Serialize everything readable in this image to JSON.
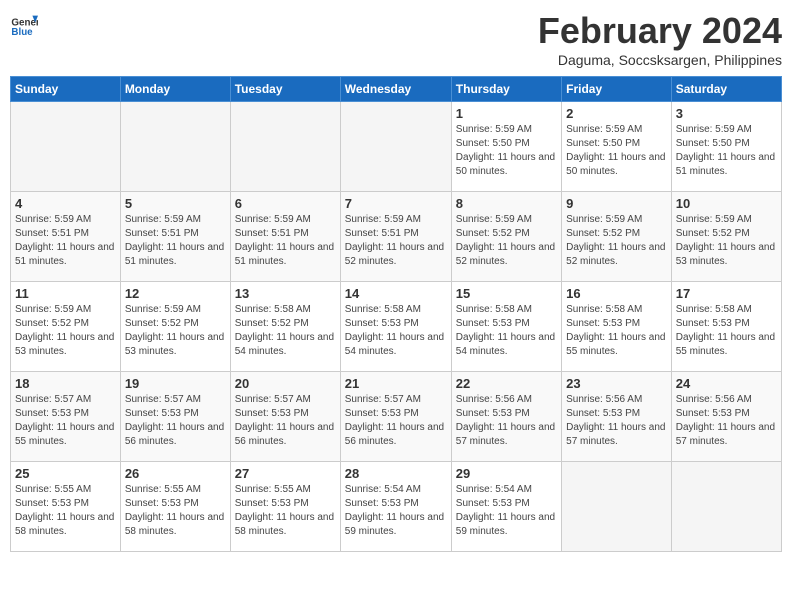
{
  "header": {
    "logo_line1": "General",
    "logo_line2": "Blue",
    "month_title": "February 2024",
    "location": "Daguma, Soccsksargen, Philippines"
  },
  "weekdays": [
    "Sunday",
    "Monday",
    "Tuesday",
    "Wednesday",
    "Thursday",
    "Friday",
    "Saturday"
  ],
  "weeks": [
    [
      {
        "day": "",
        "info": ""
      },
      {
        "day": "",
        "info": ""
      },
      {
        "day": "",
        "info": ""
      },
      {
        "day": "",
        "info": ""
      },
      {
        "day": "1",
        "info": "Sunrise: 5:59 AM\nSunset: 5:50 PM\nDaylight: 11 hours and 50 minutes."
      },
      {
        "day": "2",
        "info": "Sunrise: 5:59 AM\nSunset: 5:50 PM\nDaylight: 11 hours and 50 minutes."
      },
      {
        "day": "3",
        "info": "Sunrise: 5:59 AM\nSunset: 5:50 PM\nDaylight: 11 hours and 51 minutes."
      }
    ],
    [
      {
        "day": "4",
        "info": "Sunrise: 5:59 AM\nSunset: 5:51 PM\nDaylight: 11 hours and 51 minutes."
      },
      {
        "day": "5",
        "info": "Sunrise: 5:59 AM\nSunset: 5:51 PM\nDaylight: 11 hours and 51 minutes."
      },
      {
        "day": "6",
        "info": "Sunrise: 5:59 AM\nSunset: 5:51 PM\nDaylight: 11 hours and 51 minutes."
      },
      {
        "day": "7",
        "info": "Sunrise: 5:59 AM\nSunset: 5:51 PM\nDaylight: 11 hours and 52 minutes."
      },
      {
        "day": "8",
        "info": "Sunrise: 5:59 AM\nSunset: 5:52 PM\nDaylight: 11 hours and 52 minutes."
      },
      {
        "day": "9",
        "info": "Sunrise: 5:59 AM\nSunset: 5:52 PM\nDaylight: 11 hours and 52 minutes."
      },
      {
        "day": "10",
        "info": "Sunrise: 5:59 AM\nSunset: 5:52 PM\nDaylight: 11 hours and 53 minutes."
      }
    ],
    [
      {
        "day": "11",
        "info": "Sunrise: 5:59 AM\nSunset: 5:52 PM\nDaylight: 11 hours and 53 minutes."
      },
      {
        "day": "12",
        "info": "Sunrise: 5:59 AM\nSunset: 5:52 PM\nDaylight: 11 hours and 53 minutes."
      },
      {
        "day": "13",
        "info": "Sunrise: 5:58 AM\nSunset: 5:52 PM\nDaylight: 11 hours and 54 minutes."
      },
      {
        "day": "14",
        "info": "Sunrise: 5:58 AM\nSunset: 5:53 PM\nDaylight: 11 hours and 54 minutes."
      },
      {
        "day": "15",
        "info": "Sunrise: 5:58 AM\nSunset: 5:53 PM\nDaylight: 11 hours and 54 minutes."
      },
      {
        "day": "16",
        "info": "Sunrise: 5:58 AM\nSunset: 5:53 PM\nDaylight: 11 hours and 55 minutes."
      },
      {
        "day": "17",
        "info": "Sunrise: 5:58 AM\nSunset: 5:53 PM\nDaylight: 11 hours and 55 minutes."
      }
    ],
    [
      {
        "day": "18",
        "info": "Sunrise: 5:57 AM\nSunset: 5:53 PM\nDaylight: 11 hours and 55 minutes."
      },
      {
        "day": "19",
        "info": "Sunrise: 5:57 AM\nSunset: 5:53 PM\nDaylight: 11 hours and 56 minutes."
      },
      {
        "day": "20",
        "info": "Sunrise: 5:57 AM\nSunset: 5:53 PM\nDaylight: 11 hours and 56 minutes."
      },
      {
        "day": "21",
        "info": "Sunrise: 5:57 AM\nSunset: 5:53 PM\nDaylight: 11 hours and 56 minutes."
      },
      {
        "day": "22",
        "info": "Sunrise: 5:56 AM\nSunset: 5:53 PM\nDaylight: 11 hours and 57 minutes."
      },
      {
        "day": "23",
        "info": "Sunrise: 5:56 AM\nSunset: 5:53 PM\nDaylight: 11 hours and 57 minutes."
      },
      {
        "day": "24",
        "info": "Sunrise: 5:56 AM\nSunset: 5:53 PM\nDaylight: 11 hours and 57 minutes."
      }
    ],
    [
      {
        "day": "25",
        "info": "Sunrise: 5:55 AM\nSunset: 5:53 PM\nDaylight: 11 hours and 58 minutes."
      },
      {
        "day": "26",
        "info": "Sunrise: 5:55 AM\nSunset: 5:53 PM\nDaylight: 11 hours and 58 minutes."
      },
      {
        "day": "27",
        "info": "Sunrise: 5:55 AM\nSunset: 5:53 PM\nDaylight: 11 hours and 58 minutes."
      },
      {
        "day": "28",
        "info": "Sunrise: 5:54 AM\nSunset: 5:53 PM\nDaylight: 11 hours and 59 minutes."
      },
      {
        "day": "29",
        "info": "Sunrise: 5:54 AM\nSunset: 5:53 PM\nDaylight: 11 hours and 59 minutes."
      },
      {
        "day": "",
        "info": ""
      },
      {
        "day": "",
        "info": ""
      }
    ]
  ]
}
